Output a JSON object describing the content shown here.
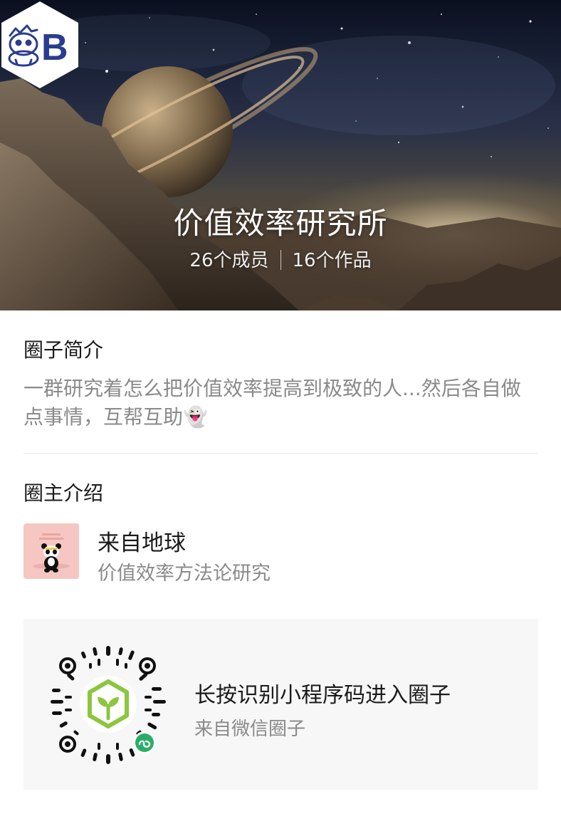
{
  "club": {
    "title": "价值效率研究所",
    "members": "26个成员",
    "works": "16个作品"
  },
  "intro": {
    "heading": "圈子简介",
    "text": "一群研究着怎么把价值效率提高到极致的人...然后各自做点事情，互帮互助👻"
  },
  "owner": {
    "heading": "圈主介绍",
    "name": "来自地球",
    "description": "价值效率方法论研究"
  },
  "qr": {
    "title": "长按识别小程序码进入圈子",
    "subtitle": "来自微信圈子"
  },
  "colors": {
    "accent_green": "#8cc63f",
    "badge_green": "#2aae67",
    "logo_blue": "#2a3c8f",
    "secondary_text": "#8a8a8a"
  },
  "icons": {
    "logo": "hippo-b-logo-icon",
    "mini_program_badge": "wechat-mini-program-icon"
  }
}
